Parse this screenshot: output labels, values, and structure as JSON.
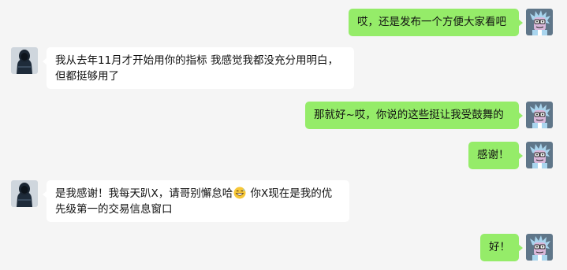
{
  "messages": [
    {
      "id": "m1",
      "side": "right",
      "sender": "me",
      "text": "哎，还是发布一个方便大家看吧"
    },
    {
      "id": "m2",
      "side": "left",
      "sender": "other",
      "line1": "我从去年11月才开始用你的指标 我感觉我都没充分用明白，",
      "line2": "但都挺够用了"
    },
    {
      "id": "m3",
      "side": "right",
      "sender": "me",
      "text": "那就好~哎，你说的这些挺让我受鼓舞的"
    },
    {
      "id": "m4",
      "side": "right",
      "sender": "me",
      "text": "感谢！"
    },
    {
      "id": "m5",
      "side": "left",
      "sender": "other",
      "line1_a": "是我感谢！我每天趴X，请哥别懈怠哈",
      "emoji": "grinning-sweat-emoji",
      "line1_b": " 你X现在是我的优",
      "line2": "先级第一的交易信息窗口"
    },
    {
      "id": "m6",
      "side": "right",
      "sender": "me",
      "text": "好！"
    }
  ],
  "colors": {
    "background": "#f5f5f5",
    "outgoing_bubble": "#95ec69",
    "incoming_bubble": "#ffffff",
    "my_avatar_bg": "#5f7689",
    "other_avatar_bg": "#cfd6dd"
  },
  "icons": {
    "my_avatar": "rick-cartoon-avatar-icon",
    "other_avatar": "hooded-figure-avatar-icon"
  }
}
